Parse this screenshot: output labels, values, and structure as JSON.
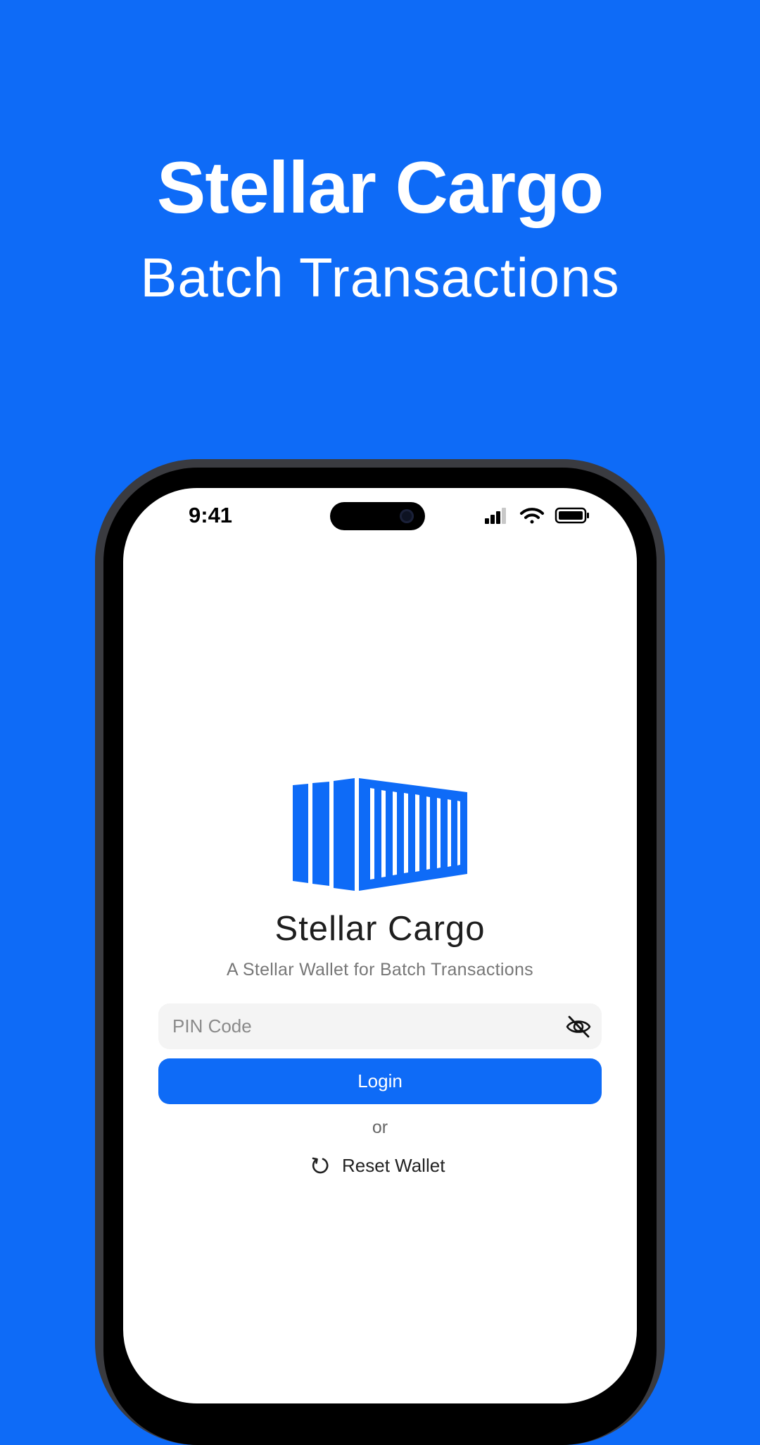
{
  "promo": {
    "headline": "Stellar Cargo",
    "subheadline": "Batch Transactions"
  },
  "status_bar": {
    "time": "9:41",
    "icons": [
      "signal-icon",
      "wifi-icon",
      "battery-icon"
    ]
  },
  "app": {
    "title": "Stellar Cargo",
    "subtitle": "A Stellar Wallet for Batch Transactions",
    "logo_icon": "cargo-container-icon"
  },
  "login_form": {
    "pin_placeholder": "PIN Code",
    "pin_value": "",
    "visibility_icon": "eye-off-icon",
    "login_label": "Login",
    "separator": "or",
    "reset_label": "Reset Wallet",
    "reset_icon": "refresh-icon"
  },
  "colors": {
    "brand_blue": "#0e6bf7",
    "background": "#0e6bf7",
    "screen": "#ffffff",
    "input_bg": "#f4f4f4"
  }
}
